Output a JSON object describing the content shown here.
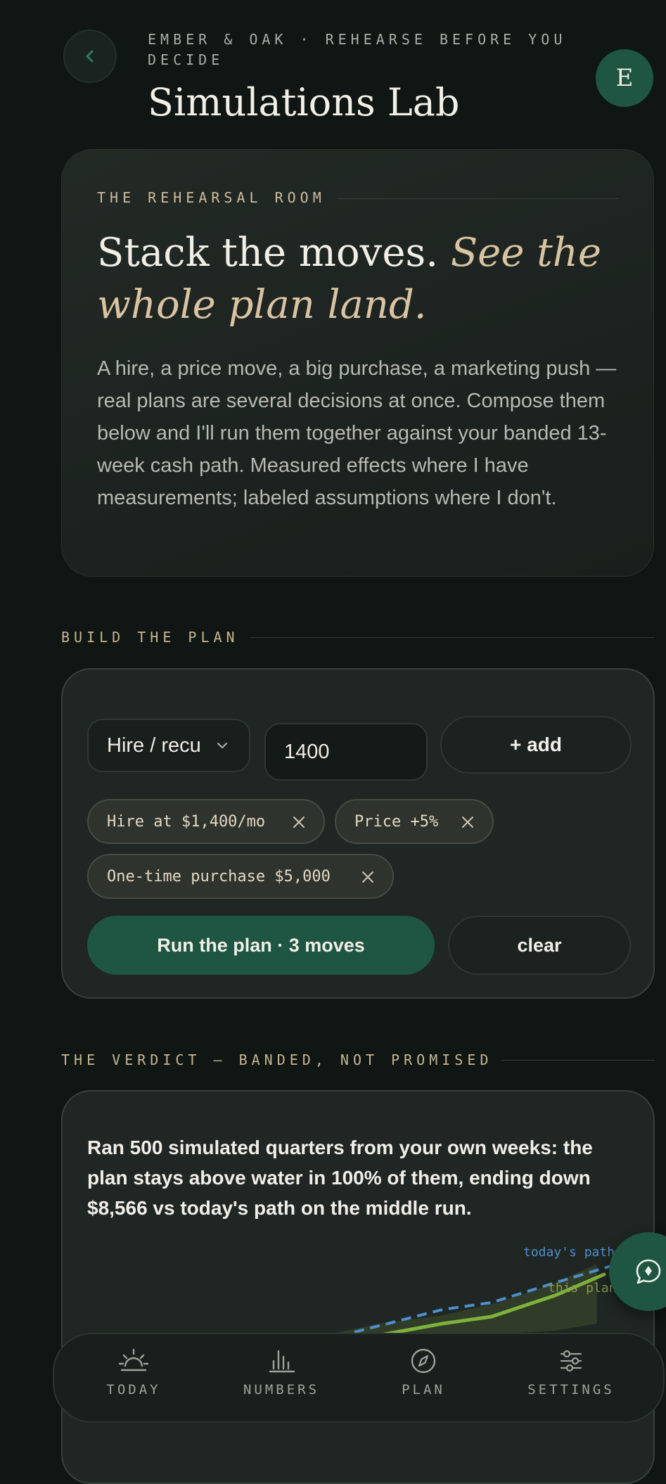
{
  "header": {
    "kicker": "EMBER & OAK · REHEARSE BEFORE YOU DECIDE",
    "title": "Simulations Lab",
    "avatar_initial": "E"
  },
  "hero": {
    "kicker": "THE REHEARSAL ROOM",
    "headline_plain": "Stack the moves.",
    "headline_accent": "See the whole plan land.",
    "body": "A hire, a price move, a big purchase, a marketing push — real plans are several decisions at once. Compose them below and I'll run them together against your banded 13-week cash path. Measured effects where I have measurements; labeled assumptions where I don't."
  },
  "build": {
    "section_label": "BUILD THE PLAN",
    "select_value": "Hire / recu",
    "amount_value": "1400",
    "add_label": "+ add",
    "chips": [
      {
        "label": "Hire at $1,400/mo"
      },
      {
        "label": "Price +5%"
      },
      {
        "label": "One-time purchase $5,000"
      }
    ],
    "run_label": "Run the plan · 3 moves",
    "clear_label": "clear"
  },
  "verdict": {
    "section_label": "THE VERDICT — BANDED, NOT PROMISED",
    "summary": "Ran 500 simulated quarters from your own weeks: the plan stays above water in 100% of them, ending down $8,566 vs today's path on the middle run.",
    "legend_today": "today's path",
    "legend_plan": "this plan",
    "colors": {
      "today": "#4f8fce",
      "plan": "#7fb23c"
    }
  },
  "nav": {
    "items": [
      {
        "label": "TODAY",
        "icon": "sunrise-icon"
      },
      {
        "label": "NUMBERS",
        "icon": "bar-chart-icon"
      },
      {
        "label": "PLAN",
        "icon": "compass-icon"
      },
      {
        "label": "SETTINGS",
        "icon": "sliders-icon"
      }
    ]
  },
  "colors": {
    "background": "#0f1613",
    "accent_green": "#1e5543",
    "accent_gold": "#d9c3a1"
  }
}
